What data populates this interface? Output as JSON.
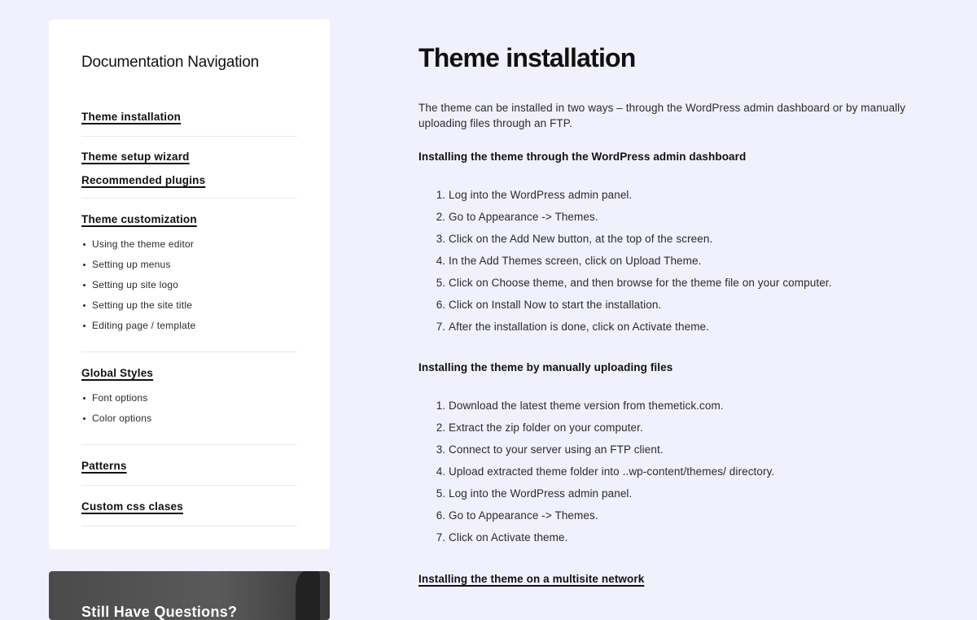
{
  "sidebar": {
    "title": "Documentation Navigation",
    "groups": [
      {
        "links": [
          "Theme installation"
        ],
        "sub": []
      },
      {
        "links": [
          "Theme setup wizard",
          "Recommended plugins"
        ],
        "sub": []
      },
      {
        "links": [
          "Theme customization"
        ],
        "sub": [
          "Using the theme editor",
          "Setting up menus",
          "Setting up site logo",
          "Setting up the site title",
          "Editing page / template"
        ]
      },
      {
        "links": [
          "Global Styles"
        ],
        "sub": [
          "Font options",
          "Color options"
        ]
      },
      {
        "links": [
          "Patterns "
        ],
        "sub": []
      },
      {
        "links": [
          "Custom css clases"
        ],
        "sub": []
      }
    ]
  },
  "promo": {
    "text": "Still Have Questions?"
  },
  "main": {
    "title": "Theme installation",
    "intro": "The theme can be installed in two ways – through the WordPress admin dashboard or by manually uploading files through an FTP.",
    "section1": {
      "heading": "Installing the theme through the WordPress admin dashboard",
      "steps": [
        "Log into the WordPress admin panel.",
        "Go to Appearance -> Themes.",
        "Click on the Add New button, at the top of the screen.",
        "In the Add Themes screen, click on Upload Theme.",
        "Click on Choose theme, and then browse for the theme file on your computer.",
        "Click on Install Now to start the installation.",
        "After the installation is done, click on Activate theme."
      ]
    },
    "section2": {
      "heading": "Installing the theme by manually uploading files",
      "steps": [
        "Download the latest theme version from themetick.com.",
        "Extract the zip folder on your computer.",
        "Connect to your server using an FTP client.",
        "Upload extracted theme folder into ..wp-content/themes/ directory.",
        "Log into the WordPress admin panel.",
        "Go to Appearance -> Themes.",
        "Click on Activate theme."
      ]
    },
    "section3": {
      "heading": "Installing the theme on a multisite network"
    }
  }
}
